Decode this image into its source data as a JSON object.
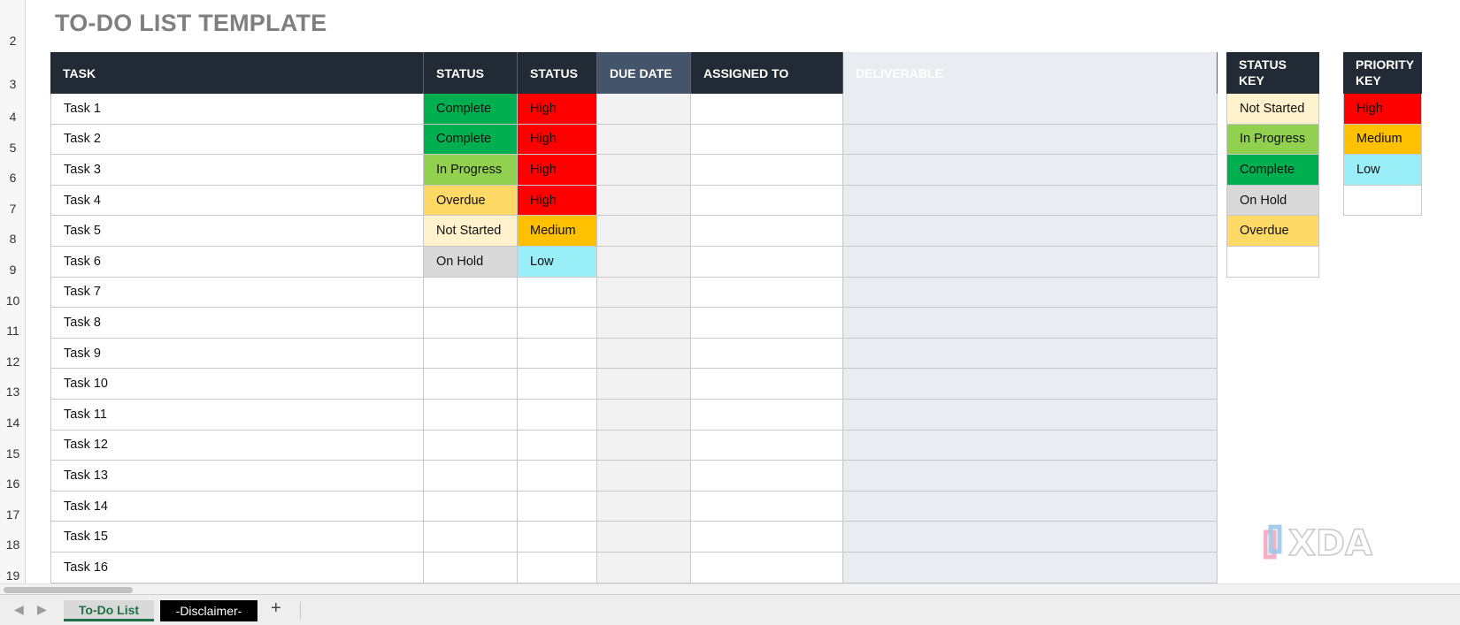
{
  "sheet_title": "TO-DO LIST TEMPLATE",
  "row_numbers": [
    "2",
    "3",
    "4",
    "5",
    "6",
    "7",
    "8",
    "9",
    "10",
    "11",
    "12",
    "13",
    "14",
    "15",
    "16",
    "17",
    "18",
    "19"
  ],
  "table": {
    "headers": [
      "TASK",
      "STATUS",
      "STATUS",
      "DUE DATE",
      "ASSIGNED TO",
      "DELIVERABLE"
    ],
    "rows": [
      {
        "task": "Task 1",
        "status": "Complete",
        "status_color": "#00b050",
        "priority": "High",
        "priority_color": "#ff0000"
      },
      {
        "task": "Task 2",
        "status": "Complete",
        "status_color": "#00b050",
        "priority": "High",
        "priority_color": "#ff0000"
      },
      {
        "task": "Task 3",
        "status": "In Progress",
        "status_color": "#92d050",
        "priority": "High",
        "priority_color": "#ff0000"
      },
      {
        "task": "Task 4",
        "status": "Overdue",
        "status_color": "#ffd966",
        "priority": "High",
        "priority_color": "#ff0000"
      },
      {
        "task": "Task 5",
        "status": "Not Started",
        "status_color": "#fff2cc",
        "priority": "Medium",
        "priority_color": "#ffc000"
      },
      {
        "task": "Task 6",
        "status": "On Hold",
        "status_color": "#d9d9d9",
        "priority": "Low",
        "priority_color": "#99eef8"
      },
      {
        "task": "Task 7",
        "status": "",
        "priority": ""
      },
      {
        "task": "Task 8",
        "status": "",
        "priority": ""
      },
      {
        "task": "Task 9",
        "status": "",
        "priority": ""
      },
      {
        "task": "Task 10",
        "status": "",
        "priority": ""
      },
      {
        "task": "Task 11",
        "status": "",
        "priority": ""
      },
      {
        "task": "Task 12",
        "status": "",
        "priority": ""
      },
      {
        "task": "Task 13",
        "status": "",
        "priority": ""
      },
      {
        "task": "Task 14",
        "status": "",
        "priority": ""
      },
      {
        "task": "Task 15",
        "status": "",
        "priority": ""
      },
      {
        "task": "Task 16",
        "status": "",
        "priority": ""
      }
    ]
  },
  "status_key": {
    "header": "STATUS KEY",
    "items": [
      {
        "label": "Not Started",
        "color": "#fff2cc"
      },
      {
        "label": "In Progress",
        "color": "#92d050"
      },
      {
        "label": "Complete",
        "color": "#00b050"
      },
      {
        "label": "On Hold",
        "color": "#d9d9d9"
      },
      {
        "label": "Overdue",
        "color": "#ffd966"
      },
      {
        "label": "",
        "color": "#ffffff"
      }
    ]
  },
  "priority_key": {
    "header": "PRIORITY KEY",
    "items": [
      {
        "label": "High",
        "color": "#ff0000"
      },
      {
        "label": "Medium",
        "color": "#ffc000"
      },
      {
        "label": "Low",
        "color": "#99eef8"
      },
      {
        "label": "",
        "color": "#ffffff"
      }
    ]
  },
  "sheet_tabs": [
    {
      "label": "To-Do List",
      "active": true
    },
    {
      "label": "-Disclaimer-",
      "active": false
    }
  ],
  "add_sheet_label": "+",
  "watermark_text": "XDA",
  "colors": {
    "header_bg": "#222a35",
    "due_header_bg": "#44546a",
    "title": "#7f7f7f"
  }
}
